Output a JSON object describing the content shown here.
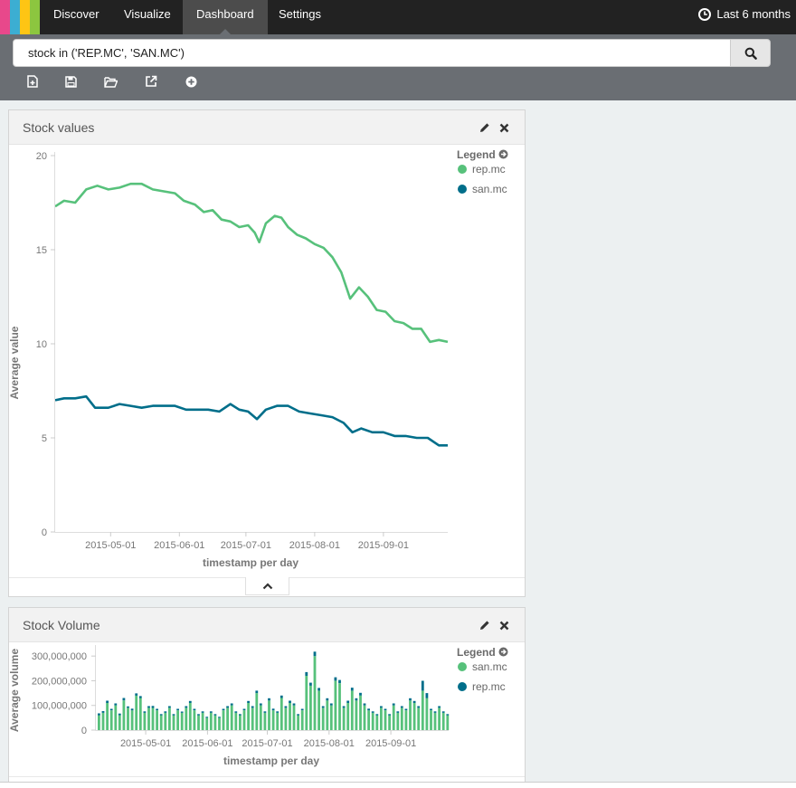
{
  "nav": {
    "tabs": [
      {
        "label": "Discover"
      },
      {
        "label": "Visualize"
      },
      {
        "label": "Dashboard"
      },
      {
        "label": "Settings"
      }
    ],
    "logo_colors": [
      "#e8488b",
      "#3caed2",
      "#fec514",
      "#8cc63f"
    ],
    "timepicker": {
      "label": "Last 6 months",
      "icon": "clock-icon"
    }
  },
  "search": {
    "query": "stock in ('REP.MC', 'SAN.MC')",
    "button_icon": "search-icon"
  },
  "toolbar": {
    "icons": [
      "new-dashboard-icon",
      "save-icon",
      "open-icon",
      "share-icon",
      "add-panel-icon"
    ]
  },
  "panels": [
    {
      "title": "Stock values",
      "legend": {
        "title": "Legend",
        "items": [
          {
            "name": "rep.mc",
            "color": "#57c17b"
          },
          {
            "name": "san.mc",
            "color": "#006e8a"
          }
        ]
      }
    },
    {
      "title": "Stock Volume",
      "legend": {
        "title": "Legend",
        "items": [
          {
            "name": "san.mc",
            "color": "#57c17b"
          },
          {
            "name": "rep.mc",
            "color": "#006e8a"
          }
        ]
      }
    }
  ],
  "chart_data": [
    {
      "type": "line",
      "xlabel": "timestamp per day",
      "ylabel": "Average value",
      "ylim": [
        0,
        20
      ],
      "yticks": [
        "0",
        "5",
        "10",
        "15",
        "20"
      ],
      "xticks": [
        "2015-05-01",
        "2015-06-01",
        "2015-07-01",
        "2015-08-01",
        "2015-09-01"
      ],
      "xrange": [
        "2015-04-06",
        "2015-09-30"
      ],
      "series": [
        {
          "name": "rep.mc",
          "color": "#57c17b",
          "points": [
            [
              "2015-04-06",
              17.3
            ],
            [
              "2015-04-10",
              17.6
            ],
            [
              "2015-04-15",
              17.5
            ],
            [
              "2015-04-20",
              18.2
            ],
            [
              "2015-04-25",
              18.4
            ],
            [
              "2015-04-30",
              18.2
            ],
            [
              "2015-05-05",
              18.3
            ],
            [
              "2015-05-10",
              18.5
            ],
            [
              "2015-05-15",
              18.5
            ],
            [
              "2015-05-20",
              18.2
            ],
            [
              "2015-05-25",
              18.1
            ],
            [
              "2015-05-30",
              18.0
            ],
            [
              "2015-06-03",
              17.6
            ],
            [
              "2015-06-08",
              17.4
            ],
            [
              "2015-06-12",
              17.0
            ],
            [
              "2015-06-16",
              17.1
            ],
            [
              "2015-06-20",
              16.6
            ],
            [
              "2015-06-24",
              16.5
            ],
            [
              "2015-06-28",
              16.2
            ],
            [
              "2015-07-02",
              16.3
            ],
            [
              "2015-07-05",
              15.9
            ],
            [
              "2015-07-07",
              15.4
            ],
            [
              "2015-07-10",
              16.4
            ],
            [
              "2015-07-14",
              16.8
            ],
            [
              "2015-07-17",
              16.7
            ],
            [
              "2015-07-20",
              16.2
            ],
            [
              "2015-07-24",
              15.8
            ],
            [
              "2015-07-28",
              15.6
            ],
            [
              "2015-08-01",
              15.3
            ],
            [
              "2015-08-05",
              15.1
            ],
            [
              "2015-08-09",
              14.6
            ],
            [
              "2015-08-13",
              13.8
            ],
            [
              "2015-08-17",
              12.4
            ],
            [
              "2015-08-21",
              13.0
            ],
            [
              "2015-08-25",
              12.5
            ],
            [
              "2015-08-29",
              11.8
            ],
            [
              "2015-09-02",
              11.7
            ],
            [
              "2015-09-06",
              11.2
            ],
            [
              "2015-09-10",
              11.1
            ],
            [
              "2015-09-14",
              10.8
            ],
            [
              "2015-09-18",
              10.8
            ],
            [
              "2015-09-22",
              10.1
            ],
            [
              "2015-09-26",
              10.2
            ],
            [
              "2015-09-30",
              10.1
            ]
          ]
        },
        {
          "name": "san.mc",
          "color": "#006e8a",
          "points": [
            [
              "2015-04-06",
              7.0
            ],
            [
              "2015-04-10",
              7.1
            ],
            [
              "2015-04-15",
              7.1
            ],
            [
              "2015-04-20",
              7.2
            ],
            [
              "2015-04-24",
              6.6
            ],
            [
              "2015-04-30",
              6.6
            ],
            [
              "2015-05-05",
              6.8
            ],
            [
              "2015-05-10",
              6.7
            ],
            [
              "2015-05-15",
              6.6
            ],
            [
              "2015-05-20",
              6.7
            ],
            [
              "2015-05-25",
              6.7
            ],
            [
              "2015-05-30",
              6.7
            ],
            [
              "2015-06-04",
              6.5
            ],
            [
              "2015-06-09",
              6.5
            ],
            [
              "2015-06-14",
              6.5
            ],
            [
              "2015-06-19",
              6.4
            ],
            [
              "2015-06-24",
              6.8
            ],
            [
              "2015-06-28",
              6.5
            ],
            [
              "2015-07-02",
              6.4
            ],
            [
              "2015-07-06",
              6.0
            ],
            [
              "2015-07-10",
              6.5
            ],
            [
              "2015-07-15",
              6.7
            ],
            [
              "2015-07-20",
              6.7
            ],
            [
              "2015-07-25",
              6.4
            ],
            [
              "2015-07-30",
              6.3
            ],
            [
              "2015-08-04",
              6.2
            ],
            [
              "2015-08-09",
              6.1
            ],
            [
              "2015-08-14",
              5.8
            ],
            [
              "2015-08-18",
              5.3
            ],
            [
              "2015-08-22",
              5.5
            ],
            [
              "2015-08-27",
              5.3
            ],
            [
              "2015-09-01",
              5.3
            ],
            [
              "2015-09-06",
              5.1
            ],
            [
              "2015-09-11",
              5.1
            ],
            [
              "2015-09-16",
              5.0
            ],
            [
              "2015-09-21",
              5.0
            ],
            [
              "2015-09-26",
              4.6
            ],
            [
              "2015-09-30",
              4.6
            ]
          ]
        }
      ]
    },
    {
      "type": "bar",
      "xlabel": "timestamp per day",
      "ylabel": "Average volume",
      "ylim": [
        0,
        330000000
      ],
      "yticks": [
        "0",
        "100,000,000",
        "200,000,000",
        "300,000,000"
      ],
      "xticks": [
        "2015-05-01",
        "2015-06-01",
        "2015-07-01",
        "2015-08-01",
        "2015-09-01"
      ],
      "xrange": [
        "2015-04-06",
        "2015-09-30"
      ],
      "series": [
        {
          "name": "san.mc",
          "color": "#57c17b",
          "values": [
            60000000,
            70000000,
            110000000,
            80000000,
            100000000,
            60000000,
            120000000,
            90000000,
            80000000,
            140000000,
            130000000,
            70000000,
            90000000,
            90000000,
            80000000,
            60000000,
            70000000,
            90000000,
            60000000,
            80000000,
            70000000,
            90000000,
            110000000,
            80000000,
            60000000,
            70000000,
            50000000,
            70000000,
            60000000,
            50000000,
            80000000,
            90000000,
            100000000,
            70000000,
            60000000,
            80000000,
            110000000,
            90000000,
            150000000,
            100000000,
            70000000,
            120000000,
            80000000,
            70000000,
            130000000,
            90000000,
            110000000,
            100000000,
            60000000,
            80000000,
            220000000,
            180000000,
            300000000,
            160000000,
            90000000,
            120000000,
            100000000,
            200000000,
            190000000,
            90000000,
            110000000,
            160000000,
            120000000,
            140000000,
            100000000,
            80000000,
            70000000,
            60000000,
            90000000,
            80000000,
            60000000,
            100000000,
            70000000,
            90000000,
            80000000,
            120000000,
            110000000,
            90000000,
            160000000,
            130000000,
            80000000,
            70000000,
            90000000,
            70000000,
            60000000
          ]
        },
        {
          "name": "rep.mc",
          "color": "#006e8a",
          "values": [
            8000000,
            7000000,
            9000000,
            6000000,
            8000000,
            7000000,
            10000000,
            6000000,
            7000000,
            9000000,
            8000000,
            6000000,
            7000000,
            8000000,
            6000000,
            5000000,
            6000000,
            7000000,
            5000000,
            6000000,
            5000000,
            7000000,
            8000000,
            6000000,
            5000000,
            6000000,
            4000000,
            6000000,
            5000000,
            4000000,
            6000000,
            7000000,
            8000000,
            6000000,
            5000000,
            6000000,
            8000000,
            7000000,
            10000000,
            8000000,
            6000000,
            9000000,
            7000000,
            6000000,
            10000000,
            7000000,
            9000000,
            8000000,
            5000000,
            6000000,
            15000000,
            12000000,
            18000000,
            11000000,
            7000000,
            9000000,
            8000000,
            14000000,
            13000000,
            7000000,
            9000000,
            12000000,
            9000000,
            11000000,
            8000000,
            7000000,
            6000000,
            5000000,
            7000000,
            6000000,
            5000000,
            8000000,
            6000000,
            7000000,
            6000000,
            9000000,
            8000000,
            7000000,
            40000000,
            20000000,
            6000000,
            6000000,
            7000000,
            6000000,
            5000000
          ]
        }
      ]
    }
  ]
}
